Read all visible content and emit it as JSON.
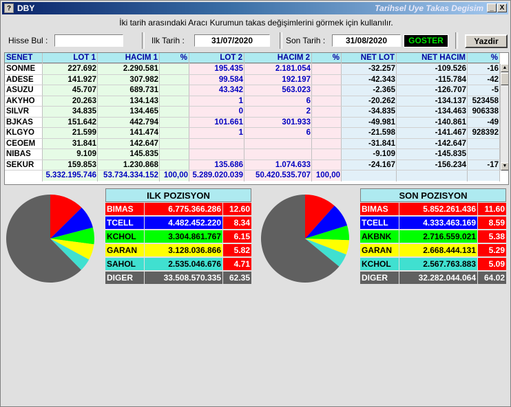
{
  "window": {
    "title": "DBY",
    "subtitle": "Tarihsel Uye Takas Degisim",
    "min_glyph": "_",
    "close_glyph": "X",
    "app_glyph": "?"
  },
  "hint": "İki tarih arasındaki  Aracı Kurumun takas değişimlerini görmek için kullanılır.",
  "filter": {
    "hisse_label": "Hisse Bul :",
    "hisse_value": "",
    "ilk_label": "Ilk Tarih :",
    "ilk_value": "31/07/2020",
    "son_label": "Son Tarih :",
    "son_value": "31/08/2020",
    "goster": "GOSTER",
    "yazdir": "Yazdir"
  },
  "grid": {
    "headers": [
      "SENET",
      "LOT 1",
      "HACIM 1",
      "%",
      "LOT 2",
      "HACIM 2",
      "%",
      "NET LOT",
      "NET HACIM",
      "%"
    ],
    "rows": [
      [
        "SONME",
        "227.692",
        "2.290.581",
        "",
        "195.435",
        "2.181.054",
        "",
        "-32.257",
        "-109.526",
        "-16"
      ],
      [
        "ADESE",
        "141.927",
        "307.982",
        "",
        "99.584",
        "192.197",
        "",
        "-42.343",
        "-115.784",
        "-42"
      ],
      [
        "ASUZU",
        "45.707",
        "689.731",
        "",
        "43.342",
        "563.023",
        "",
        "-2.365",
        "-126.707",
        "-5"
      ],
      [
        "AKYHO",
        "20.263",
        "134.143",
        "",
        "1",
        "6",
        "",
        "-20.262",
        "-134.137",
        "523458"
      ],
      [
        "SILVR",
        "34.835",
        "134.465",
        "",
        "0",
        "2",
        "",
        "-34.835",
        "-134.463",
        "906338"
      ],
      [
        "BJKAS",
        "151.642",
        "442.794",
        "",
        "101.661",
        "301.933",
        "",
        "-49.981",
        "-140.861",
        "-49"
      ],
      [
        "KLGYO",
        "21.599",
        "141.474",
        "",
        "1",
        "6",
        "",
        "-21.598",
        "-141.467",
        "928392"
      ],
      [
        "CEOEM",
        "31.841",
        "142.647",
        "",
        "",
        "",
        "",
        "-31.841",
        "-142.647",
        ""
      ],
      [
        "NIBAS",
        "9.109",
        "145.835",
        "",
        "",
        "",
        "",
        "-9.109",
        "-145.835",
        ""
      ],
      [
        "SEKUR",
        "159.853",
        "1.230.868",
        "",
        "135.686",
        "1.074.633",
        "",
        "-24.167",
        "-156.234",
        "-17"
      ]
    ],
    "totals": [
      "",
      "5.332.195.746",
      "53.734.334.152",
      "100,00",
      "5.289.020.039",
      "50.420.535.707",
      "100,00",
      "",
      "",
      ""
    ]
  },
  "ilk": {
    "title": "ILK POZISYON",
    "rows": [
      {
        "name": "BIMAS",
        "value": "6.775.366.286",
        "pct": "12.60",
        "bg": "#ff0000",
        "fg": "#ffffff"
      },
      {
        "name": "TCELL",
        "value": "4.482.452.220",
        "pct": "8.34",
        "bg": "#0000ff",
        "fg": "#ffffff"
      },
      {
        "name": "KCHOL",
        "value": "3.304.861.767",
        "pct": "6.15",
        "bg": "#00ff00",
        "fg": "#000000"
      },
      {
        "name": "GARAN",
        "value": "3.128.036.866",
        "pct": "5.82",
        "bg": "#ffff00",
        "fg": "#000000"
      },
      {
        "name": "SAHOL",
        "value": "2.535.046.676",
        "pct": "4.71",
        "bg": "#40e0d0",
        "fg": "#000000"
      },
      {
        "name": "DIGER",
        "value": "33.508.570.335",
        "pct": "62.35",
        "bg": "#606060",
        "fg": "#ffffff"
      }
    ]
  },
  "son": {
    "title": "SON POZISYON",
    "rows": [
      {
        "name": "BIMAS",
        "value": "5.852.261.436",
        "pct": "11.60",
        "bg": "#ff0000",
        "fg": "#ffffff"
      },
      {
        "name": "TCELL",
        "value": "4.333.463.169",
        "pct": "8.59",
        "bg": "#0000ff",
        "fg": "#ffffff"
      },
      {
        "name": "AKBNK",
        "value": "2.716.559.021",
        "pct": "5.38",
        "bg": "#00ff00",
        "fg": "#000000"
      },
      {
        "name": "GARAN",
        "value": "2.668.444.131",
        "pct": "5.29",
        "bg": "#ffff00",
        "fg": "#000000"
      },
      {
        "name": "KCHOL",
        "value": "2.567.763.883",
        "pct": "5.09",
        "bg": "#40e0d0",
        "fg": "#000000"
      },
      {
        "name": "DIGER",
        "value": "32.282.044.064",
        "pct": "64.02",
        "bg": "#606060",
        "fg": "#ffffff"
      }
    ]
  }
}
